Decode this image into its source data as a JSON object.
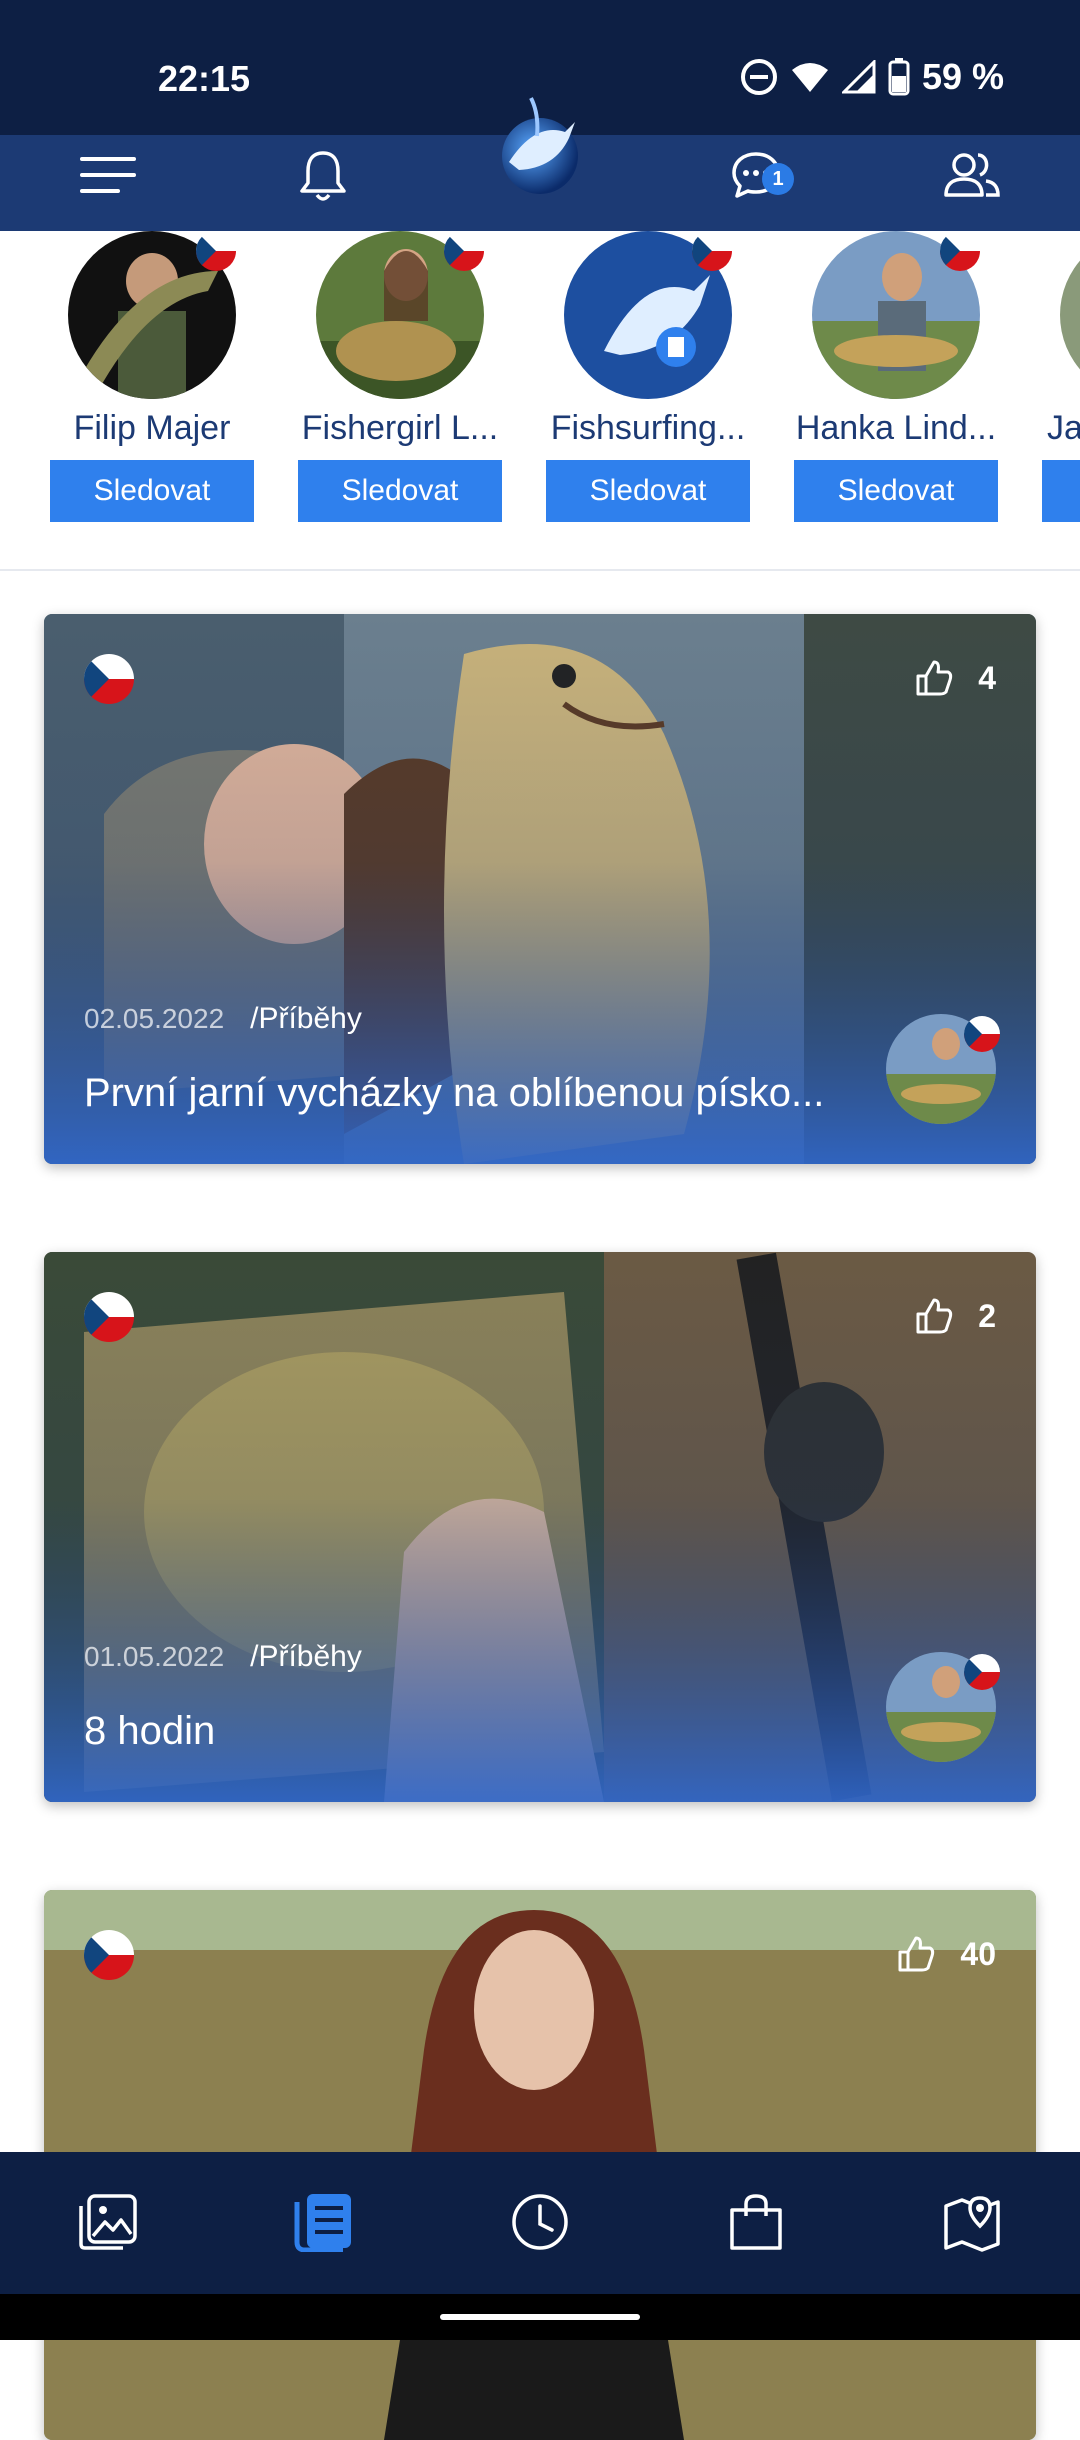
{
  "status_bar": {
    "time": "22:15",
    "battery": "59 %"
  },
  "header": {
    "menu_icon": "hamburger-menu-icon",
    "notifications_icon": "bell-icon",
    "messages_icon": "chat-bubble-icon",
    "messages_badge": "1",
    "people_icon": "people-icon",
    "logo": "fishsurfing-logo"
  },
  "follow_suggestions": [
    {
      "name": "Filip Majer",
      "button": "Sledovat"
    },
    {
      "name": "Fishergirl L...",
      "button": "Sledovat"
    },
    {
      "name": "Fishsurfing...",
      "button": "Sledovat"
    },
    {
      "name": "Hanka Lind...",
      "button": "Sledovat"
    },
    {
      "name": "Ja",
      "button": ""
    }
  ],
  "posts": [
    {
      "date": "02.05.2022",
      "category": "/Příběhy",
      "title": "První jarní vycházky na oblíbenou písko...",
      "likes": "4"
    },
    {
      "date": "01.05.2022",
      "category": "/Příběhy",
      "title": "8 hodin",
      "likes": "2"
    },
    {
      "date": "",
      "category": "",
      "title": "",
      "likes": "40"
    }
  ],
  "bottom_nav": [
    {
      "icon": "gallery-icon",
      "active": false
    },
    {
      "icon": "articles-icon",
      "active": true
    },
    {
      "icon": "clock-icon",
      "active": false
    },
    {
      "icon": "shopping-bag-icon",
      "active": false
    },
    {
      "icon": "map-pin-icon",
      "active": false
    }
  ],
  "colors": {
    "header_bg": "#1c3a74",
    "status_bg": "#0d1f44",
    "accent": "#2f80ed"
  }
}
